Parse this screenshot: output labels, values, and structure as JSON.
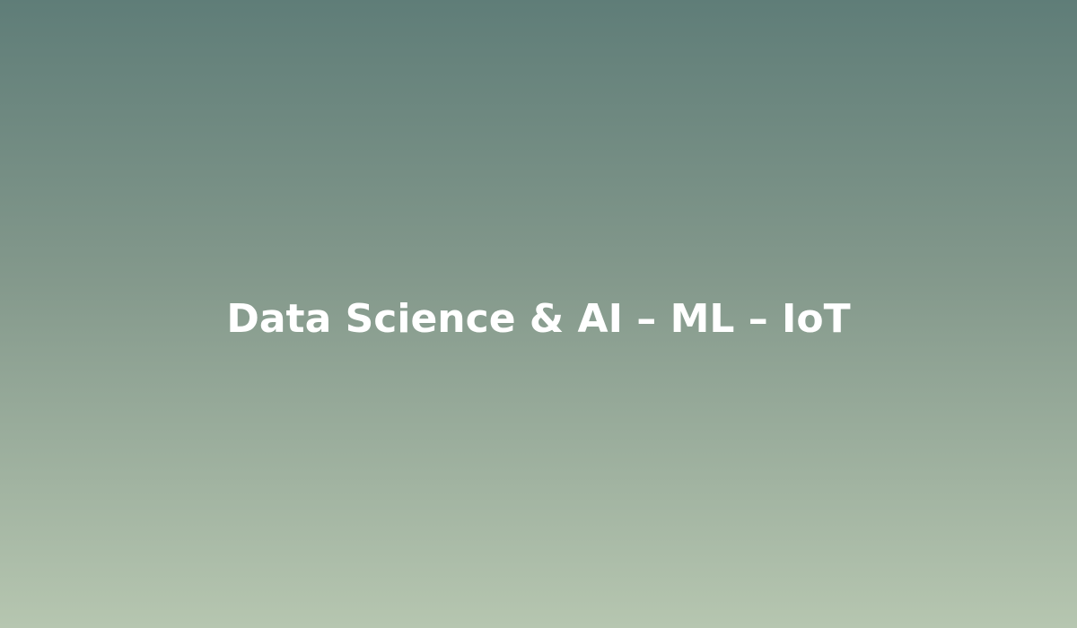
{
  "hero": {
    "title": "Data Science & AI – ML – IoT"
  },
  "colors": {
    "gradient_top": "#5f7d78",
    "gradient_bottom": "#b6c6b0",
    "title_text": "#ffffff"
  }
}
